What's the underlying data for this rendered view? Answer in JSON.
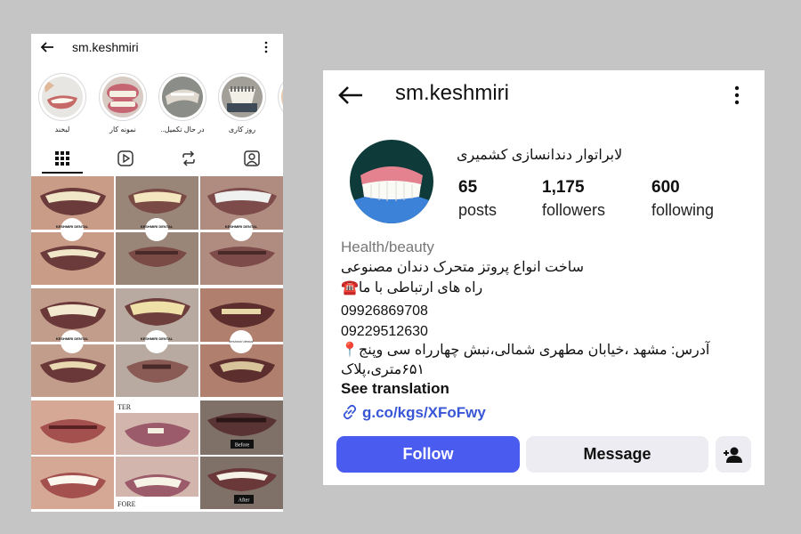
{
  "left": {
    "username": "sm.keshmiri",
    "highlights": [
      {
        "label": "لبخند"
      },
      {
        "label": "نمونه کار"
      },
      {
        "label": "در حال تکمیل.."
      },
      {
        "label": "روز کاری"
      }
    ],
    "tabs": [
      "grid-icon",
      "reels-icon",
      "reposts-icon",
      "tagged-icon"
    ],
    "posts": [
      {
        "overlay": "KESHMIRI DENTAL"
      },
      {
        "overlay": "KESHMIRI DENTAL"
      },
      {
        "overlay": "KESHMIRI DENTAL"
      },
      {
        "overlay": "KESHMIRI DENTAL"
      },
      {
        "overlay": "KESHMIRI DENTAL"
      },
      {
        "overlay": "keshmiri dental"
      },
      {
        "overlay": "TER"
      },
      {
        "overlay": "Before"
      },
      {
        "overlay": "FORE"
      },
      {
        "overlay": "After"
      }
    ]
  },
  "profile": {
    "username": "sm.keshmiri",
    "display_name": "لابراتوار دندانسازی کشمیری",
    "posts_count": "65",
    "posts_label": "posts",
    "followers_count": "1,175",
    "followers_label": "followers",
    "following_count": "600",
    "following_label": "following",
    "category": "Health/beauty",
    "bio_line1": "ساخت انواع پروتز متحرک دندان مصنوعی",
    "bio_line2": "راه های ارتباطی با ما☎️",
    "phone1": "09926869708",
    "phone2": "09229512630",
    "address_line1": "آدرس: مشهد ،خیابان مطهری شمالی،نبش چهارراه سی وپنج📍",
    "address_line2": "۶۵۱متری،پلاک",
    "see_translation": "See translation",
    "link": "g.co/kgs/XFoFwy",
    "follow_label": "Follow",
    "message_label": "Message"
  },
  "colors": {
    "follow_button": "#4a5cf0",
    "link": "#3856d6",
    "secondary_button": "#ececf2",
    "background": "#c5c5c5"
  }
}
